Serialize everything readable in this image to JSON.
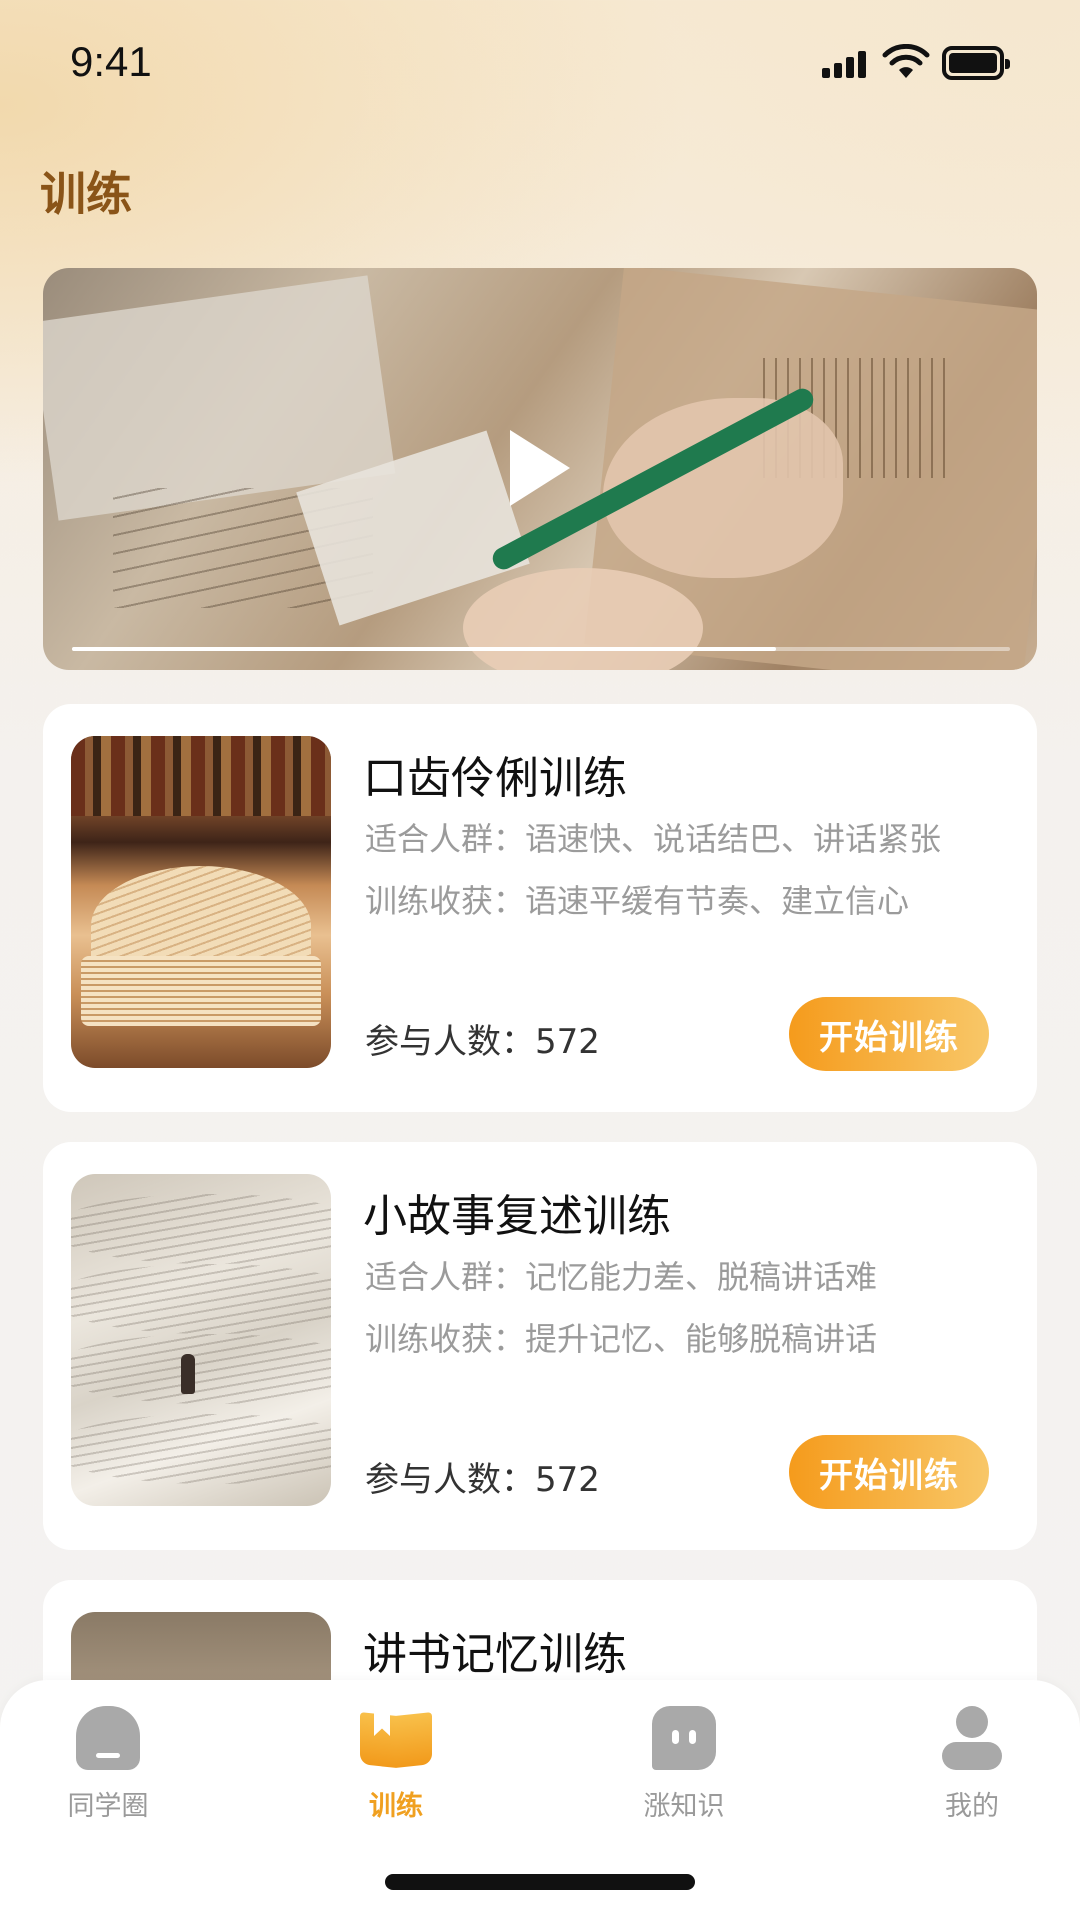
{
  "status_bar": {
    "time": "9:41"
  },
  "header": {
    "title": "训练"
  },
  "video": {
    "progress": 0.75
  },
  "trainings": [
    {
      "title": "口齿伶俐训练",
      "audience_label": "适合人群：",
      "audience": "语速快、说话结巴、讲话紧张",
      "benefit_label": "训练收获：",
      "benefit": "语速平缓有节奏、建立信心",
      "count_label": "参与人数：",
      "count": "572",
      "button": "开始训练"
    },
    {
      "title": "小故事复述训练",
      "audience_label": "适合人群：",
      "audience": "记忆能力差、脱稿讲话难",
      "benefit_label": "训练收获：",
      "benefit": "提升记忆、能够脱稿讲话",
      "count_label": "参与人数：",
      "count": "572",
      "button": "开始训练"
    },
    {
      "title": "讲书记忆训练"
    }
  ],
  "tabbar": {
    "items": [
      {
        "label": "同学圈",
        "icon": "home-icon",
        "active": false
      },
      {
        "label": "训练",
        "icon": "book-icon",
        "active": true
      },
      {
        "label": "涨知识",
        "icon": "chat-icon",
        "active": false
      },
      {
        "label": "我的",
        "icon": "profile-icon",
        "active": false
      }
    ]
  },
  "colors": {
    "accent": "#f5a01f",
    "title": "#8a5418",
    "muted": "#9b9b9b"
  }
}
